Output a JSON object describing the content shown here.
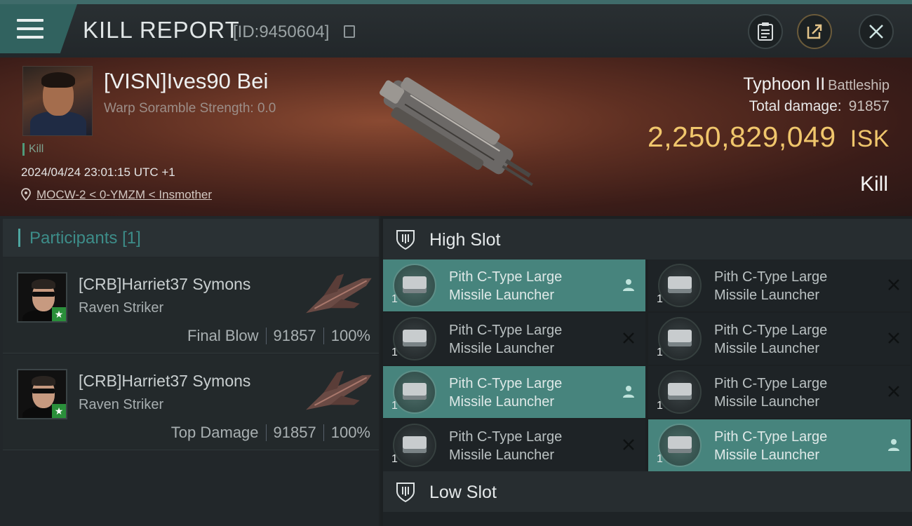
{
  "header": {
    "title": "KILL REPORT",
    "report_id": "[ID:9450604]"
  },
  "victim": {
    "pilot": "[VISN]Ives90 Bei",
    "warp_scramble": "Warp Soramble Strength: 0.0",
    "status_tag": "Kill",
    "datetime": "2024/04/24 23:01:15 UTC +1",
    "location": "MOCW-2 < 0-YMZM < Insmother",
    "ship_name": "Typhoon II",
    "ship_class": "Battleship",
    "total_damage_label": "Total damage:",
    "total_damage": "91857",
    "isk_value": "2,250,829,049",
    "isk_unit": "ISK",
    "result": "Kill"
  },
  "participants": {
    "label": "Participants",
    "count": "[1]",
    "rows": [
      {
        "name": "[CRB]Harriet37 Symons",
        "ship": "Raven Striker",
        "role": "Final Blow",
        "damage": "91857",
        "percent": "100%"
      },
      {
        "name": "[CRB]Harriet37 Symons",
        "ship": "Raven Striker",
        "role": "Top Damage",
        "damage": "91857",
        "percent": "100%"
      }
    ]
  },
  "slots": {
    "high_label": "High Slot",
    "low_label": "Low Slot",
    "modules": [
      {
        "line1": "Pith C-Type Large",
        "line2": "Missile Launcher",
        "qty": "1",
        "state": "dropped"
      },
      {
        "line1": "Pith C-Type Large",
        "line2": "Missile Launcher",
        "qty": "1",
        "state": "destroyed"
      },
      {
        "line1": "Pith C-Type Large",
        "line2": "Missile Launcher",
        "qty": "1",
        "state": "destroyed"
      },
      {
        "line1": "Pith C-Type Large",
        "line2": "Missile Launcher",
        "qty": "1",
        "state": "destroyed"
      },
      {
        "line1": "Pith C-Type Large",
        "line2": "Missile Launcher",
        "qty": "1",
        "state": "dropped"
      },
      {
        "line1": "Pith C-Type Large",
        "line2": "Missile Launcher",
        "qty": "1",
        "state": "destroyed"
      },
      {
        "line1": "Pith C-Type Large",
        "line2": "Missile Launcher",
        "qty": "1",
        "state": "destroyed"
      },
      {
        "line1": "Pith C-Type Large",
        "line2": "Missile Launcher",
        "qty": "1",
        "state": "dropped"
      }
    ]
  },
  "colors": {
    "accent_teal": "#47847d",
    "isk_gold": "#f0c66c",
    "status_green": "#2a8f3a"
  },
  "icons": [
    "menu-icon",
    "copy-icon",
    "clipboard-icon",
    "share-icon",
    "close-icon",
    "location-pin-icon",
    "shield-icon",
    "x-icon",
    "person-icon",
    "star-icon"
  ]
}
